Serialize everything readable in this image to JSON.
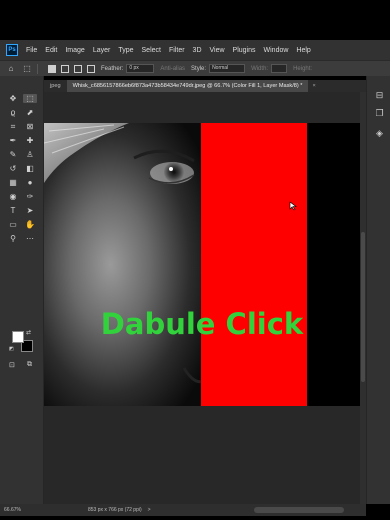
{
  "app": {
    "logo": "Ps"
  },
  "menu": [
    "File",
    "Edit",
    "Image",
    "Layer",
    "Type",
    "Select",
    "Filter",
    "3D",
    "View",
    "Plugins",
    "Window",
    "Help"
  ],
  "options": {
    "feather_label": "Feather:",
    "feather_value": "0 px",
    "antialias_label": "Anti-alias",
    "style_label": "Style:",
    "style_value": "Normal",
    "width_label": "Width:",
    "height_label": "Height:"
  },
  "tabs": [
    {
      "label": "jpeg",
      "active": false
    },
    {
      "label": "Whisk_c6856157866eb6f873a473b58434e749dr.jpeg @ 66.7% (Color Fill 1, Layer Mask/8) *",
      "active": true,
      "close": "×"
    }
  ],
  "canvas": {
    "caption": "Dabule Click",
    "fill_color": "#ff0000",
    "caption_color": "#32d23c"
  },
  "colors": {
    "foreground": "#ffffff",
    "background": "#000000"
  },
  "status": {
    "zoom": "66.67%",
    "doc_size": "853 px x 766 px (72 ppi)",
    "arrow": ">"
  },
  "tools": [
    "move-tool-icon",
    "marquee-tool-icon",
    "lasso-tool-icon",
    "object-select-tool-icon",
    "crop-tool-icon",
    "frame-tool-icon",
    "eyedropper-tool-icon",
    "healing-brush-icon",
    "brush-tool-icon",
    "clone-stamp-icon",
    "history-brush-icon",
    "eraser-tool-icon",
    "gradient-tool-icon",
    "blur-tool-icon",
    "dodge-tool-icon",
    "pen-tool-icon",
    "type-tool-icon",
    "path-select-tool-icon",
    "rectangle-tool-icon",
    "hand-tool-icon",
    "zoom-tool-icon",
    "more-tools-icon"
  ]
}
